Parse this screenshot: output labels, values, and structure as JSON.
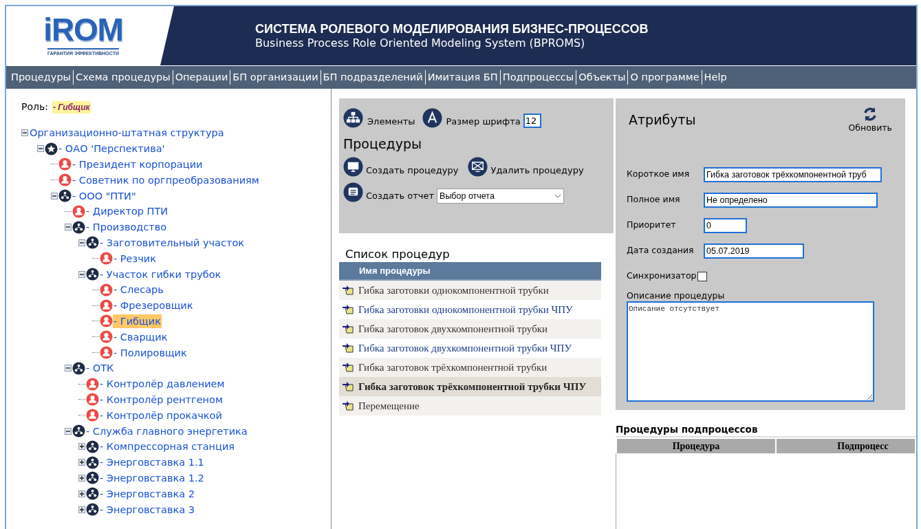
{
  "header": {
    "logo": {
      "wordmark": "iROM",
      "tagline": "ГАРАНТИЯ ЭФФЕКТИВНОСТИ"
    },
    "title": "СИСТЕМА РОЛЕВОГО МОДЕЛИРОВАНИЯ БИЗНЕС-ПРОЦЕССОВ",
    "subtitle": "Business Process Role Oriented Modeling System (BPROMS)"
  },
  "nav": [
    "Процедуры",
    "Схема процедуры",
    "Операции",
    "БП организации",
    "БП подразделений",
    "Имитация БП",
    "Подпроцессы",
    "Объекты",
    "О программе",
    "Help"
  ],
  "role": {
    "label": "Роль:",
    "value": "- Гибщик"
  },
  "tree": {
    "label": "Организационно-штатная структура",
    "expanded": true,
    "selected": false,
    "children": [
      {
        "label": "- ОАО 'Перспектива'",
        "kind": "org",
        "expanded": true,
        "selected": false,
        "children": [
          {
            "label": "- Президент корпорации",
            "kind": "role",
            "selected": false
          },
          {
            "label": "- Советник по оргпреобразованиям",
            "kind": "role",
            "selected": false
          },
          {
            "label": "- ООО \"ПТИ\"",
            "kind": "unit",
            "expanded": true,
            "selected": false,
            "children": [
              {
                "label": "- Директор ПТИ",
                "kind": "role",
                "selected": false
              },
              {
                "label": "- Производство",
                "kind": "unit",
                "expanded": true,
                "selected": false,
                "children": [
                  {
                    "label": "- Заготовительный участок",
                    "kind": "unit",
                    "expanded": true,
                    "selected": false,
                    "children": [
                      {
                        "label": "- Резчик",
                        "kind": "role",
                        "selected": false
                      }
                    ]
                  },
                  {
                    "label": "- Участок гибки трубок",
                    "kind": "unit",
                    "expanded": true,
                    "selected": false,
                    "children": [
                      {
                        "label": "- Слесарь",
                        "kind": "role",
                        "selected": false
                      },
                      {
                        "label": "- Фрезеровщик",
                        "kind": "role",
                        "selected": false
                      },
                      {
                        "label": "- Гибщик",
                        "kind": "role",
                        "selected": true
                      },
                      {
                        "label": "- Сварщик",
                        "kind": "role",
                        "selected": false
                      },
                      {
                        "label": "- Полировщик",
                        "kind": "role",
                        "selected": false
                      }
                    ]
                  }
                ]
              },
              {
                "label": "- ОТК",
                "kind": "unit",
                "expanded": true,
                "selected": false,
                "children": [
                  {
                    "label": "- Контролёр давлением",
                    "kind": "role",
                    "selected": false
                  },
                  {
                    "label": "- Контролёр рентгеном",
                    "kind": "role",
                    "selected": false
                  },
                  {
                    "label": "- Контролёр прокачкой",
                    "kind": "role",
                    "selected": false
                  }
                ]
              },
              {
                "label": "- Служба главного энергетика",
                "kind": "unit",
                "expanded": true,
                "selected": false,
                "children": [
                  {
                    "label": "- Компрессорная станция",
                    "kind": "unit",
                    "expanded": false,
                    "selected": false
                  },
                  {
                    "label": "- Энерговставка 1.1",
                    "kind": "unit",
                    "expanded": false,
                    "selected": false
                  },
                  {
                    "label": "- Энерговставка 1.2",
                    "kind": "unit",
                    "expanded": false,
                    "selected": false
                  },
                  {
                    "label": "- Энерговставка 2",
                    "kind": "unit",
                    "expanded": false,
                    "selected": false
                  },
                  {
                    "label": "- Энерговставка 3",
                    "kind": "unit",
                    "expanded": false,
                    "selected": false
                  }
                ]
              }
            ]
          }
        ]
      }
    ]
  },
  "toolbar": {
    "elements": "Элементы",
    "font_size_label": "Размер шрифта",
    "font_size": "12"
  },
  "procedures_panel": {
    "title": "Процедуры",
    "actions": [
      {
        "kind": "create",
        "label": "Создать процедуру"
      },
      {
        "kind": "delete",
        "label": "Удалить процедуру"
      }
    ],
    "report": {
      "label": "Создать отчет",
      "select": "Выбор отчета"
    }
  },
  "procedure_list": {
    "title": "Список процедур",
    "column": "Имя процедуры",
    "rows": [
      {
        "name": "Гибка заготовки однокомпонентной трубки",
        "selected": false
      },
      {
        "name": "Гибка заготовки однокомпонентной трубки ЧПУ",
        "selected": false
      },
      {
        "name": "Гибка заготовок двухкомпонентной трубки",
        "selected": false
      },
      {
        "name": "Гибка заготовок двухкомпонентной трубки ЧПУ",
        "selected": false
      },
      {
        "name": "Гибка заготовок трёхкомпонентной трубки",
        "selected": false
      },
      {
        "name": "Гибка заготовок трёхкомпонентной трубки ЧПУ",
        "selected": true
      },
      {
        "name": "Перемещение",
        "selected": false
      }
    ]
  },
  "attributes": {
    "title": "Атрибуты",
    "refresh": "Обновить",
    "fields": [
      {
        "label": "Короткое имя",
        "value": "Гибка заготовок трёхкомпонентной труб"
      },
      {
        "label": "Полное имя",
        "value": "Не определено"
      },
      {
        "label": "Приоритет",
        "value": "0"
      },
      {
        "label": "Дата создания",
        "value": "05.07.2019"
      }
    ],
    "sync": {
      "label": "Синхронизатор",
      "checked": false
    },
    "description": {
      "label": "Описание процедуры",
      "value": "Описание отсутствует"
    }
  },
  "subprocess": {
    "title": "Процедуры подпроцессов",
    "columns": [
      "Процедура",
      "Подпроцесс"
    ]
  }
}
